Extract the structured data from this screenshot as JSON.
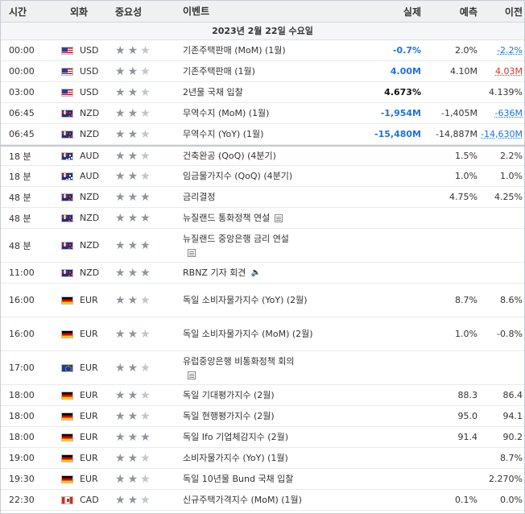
{
  "header": {
    "time": "시간",
    "currency": "외화",
    "importance": "중요성",
    "event": "이벤트",
    "actual": "실제",
    "forecast": "예측",
    "previous": "이전"
  },
  "date_label": "2023년 2월 22일 수요일",
  "colors": {
    "positive": "#1a73e8",
    "negative": "#d9342b",
    "star": "#9aa0a6"
  },
  "rows": [
    {
      "time": "00:00",
      "flag": "us",
      "currency": "USD",
      "stars": 2,
      "event": "기존주택판매 (MoM) (1월)",
      "actual": "-0.7%",
      "actual_color": "blue",
      "forecast": "2.0%",
      "previous": "-2.2%",
      "previous_color": "blue",
      "previous_ul": true
    },
    {
      "time": "00:00",
      "flag": "us",
      "currency": "USD",
      "stars": 2,
      "event": "기존주택판매 (1월)",
      "actual": "4.00M",
      "actual_color": "blue",
      "forecast": "4.10M",
      "previous": "4.03M",
      "previous_color": "red",
      "previous_ul": true
    },
    {
      "time": "03:00",
      "flag": "us",
      "currency": "USD",
      "stars": 2,
      "event": "2년물 국채 입찰",
      "actual": "4.673%",
      "actual_color": "dark",
      "forecast": "",
      "previous": "4.139%"
    },
    {
      "time": "06:45",
      "flag": "nz",
      "currency": "NZD",
      "stars": 2,
      "event": "무역수지 (MoM) (1월)",
      "actual": "-1,954M",
      "actual_color": "blue",
      "forecast": "-1,405M",
      "previous": "-636M",
      "previous_color": "blue",
      "previous_ul": true
    },
    {
      "time": "06:45",
      "flag": "nz",
      "currency": "NZD",
      "stars": 2,
      "event": "무역수지 (YoY) (1월)",
      "actual": "-15,480M",
      "actual_color": "blue",
      "forecast": "-14,887M",
      "previous": "-14,630M",
      "previous_color": "blue",
      "previous_ul": true
    },
    {
      "time": "18 분",
      "flag": "au",
      "currency": "AUD",
      "stars": 2,
      "event": "건축완공 (QoQ) (4분기)",
      "actual": "",
      "forecast": "1.5%",
      "previous": "2.2%",
      "sep": true
    },
    {
      "time": "18 분",
      "flag": "au",
      "currency": "AUD",
      "stars": 2,
      "event": "임금물가지수 (QoQ) (4분기)",
      "actual": "",
      "forecast": "1.0%",
      "previous": "1.0%"
    },
    {
      "time": "48 분",
      "flag": "nz",
      "currency": "NZD",
      "stars": 3,
      "event": "금리결정",
      "actual": "",
      "forecast": "4.75%",
      "previous": "4.25%"
    },
    {
      "time": "48 분",
      "flag": "nz",
      "currency": "NZD",
      "stars": 3,
      "event": "뉴질랜드 통화정책 연설",
      "icon": "doc-icon",
      "actual": "",
      "forecast": "",
      "previous": ""
    },
    {
      "time": "48 분",
      "flag": "nz",
      "currency": "NZD",
      "stars": 3,
      "event": "뉴질랜드 중앙은행 금리 연설",
      "icon": "doc-icon",
      "icon_newline": true,
      "actual": "",
      "forecast": "",
      "previous": ""
    },
    {
      "time": "11:00",
      "flag": "nz",
      "currency": "NZD",
      "stars": 3,
      "event": "RBNZ 기자 회견",
      "icon": "speaker-icon",
      "actual": "",
      "forecast": "",
      "previous": ""
    },
    {
      "time": "16:00",
      "flag": "de",
      "currency": "EUR",
      "stars": 2,
      "event": "독일 소비자물가지수 (YoY) (2월)",
      "actual": "",
      "forecast": "8.7%",
      "previous": "8.6%"
    },
    {
      "time": "16:00",
      "flag": "de",
      "currency": "EUR",
      "stars": 2,
      "event": "독일 소비자물가지수 (MoM) (2월)",
      "actual": "",
      "forecast": "1.0%",
      "previous": "-0.8%"
    },
    {
      "time": "17:00",
      "flag": "eu",
      "currency": "EUR",
      "stars": 2,
      "event": "유럽중앙은행 비통화정책 회의",
      "icon": "doc-icon",
      "icon_newline": true,
      "actual": "",
      "forecast": "",
      "previous": ""
    },
    {
      "time": "18:00",
      "flag": "de",
      "currency": "EUR",
      "stars": 2,
      "event": "독일 기대평가지수 (2월)",
      "actual": "",
      "forecast": "88.3",
      "previous": "86.4"
    },
    {
      "time": "18:00",
      "flag": "de",
      "currency": "EUR",
      "stars": 2,
      "event": "독일 현행평가지수 (2월)",
      "actual": "",
      "forecast": "95.0",
      "previous": "94.1"
    },
    {
      "time": "18:00",
      "flag": "de",
      "currency": "EUR",
      "stars": 3,
      "event": "독일 Ifo 기업체감지수 (2월)",
      "actual": "",
      "forecast": "91.4",
      "previous": "90.2"
    },
    {
      "time": "19:00",
      "flag": "de",
      "currency": "EUR",
      "stars": 2,
      "event": "소비자물가지수 (YoY) (1월)",
      "actual": "",
      "forecast": "",
      "previous": "8.7%"
    },
    {
      "time": "19:30",
      "flag": "de",
      "currency": "EUR",
      "stars": 2,
      "event": "독일 10년물 Bund 국채 입찰",
      "actual": "",
      "forecast": "",
      "previous": "2.270%"
    },
    {
      "time": "22:30",
      "flag": "ca",
      "currency": "CAD",
      "stars": 2,
      "event": "신규주택가격지수 (MoM) (1월)",
      "actual": "",
      "forecast": "0.1%",
      "previous": "0.0%"
    }
  ]
}
